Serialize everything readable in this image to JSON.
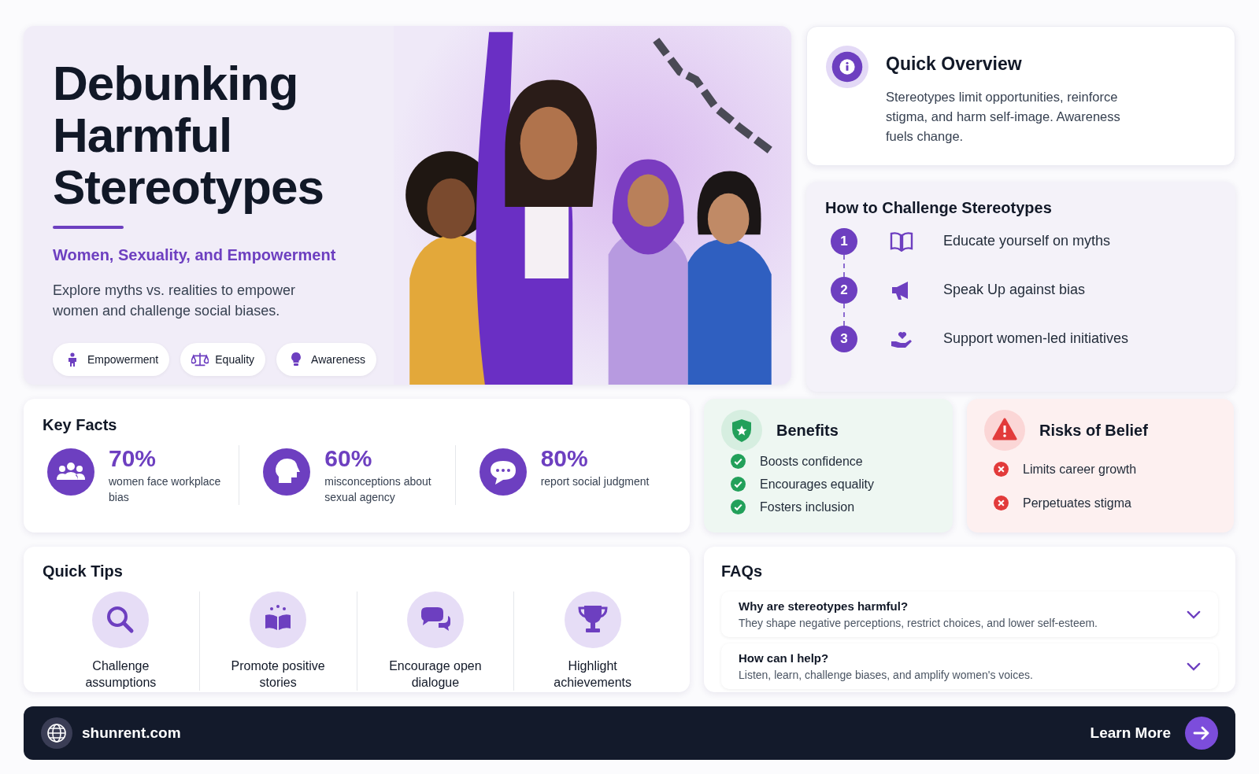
{
  "hero": {
    "title": "Debunking Harmful Stereotypes",
    "subtitle": "Women, Sexuality, and Empowerment",
    "description": "Explore myths vs. realities to empower women and challenge social biases.",
    "tags": [
      "Empowerment",
      "Equality",
      "Awareness"
    ]
  },
  "overview": {
    "title": "Quick Overview",
    "text": "Stereotypes limit opportunities, reinforce stigma, and harm self-image. Awareness fuels change."
  },
  "challenge": {
    "title": "How to Challenge Stereotypes",
    "steps": [
      {
        "number": "1",
        "text": "Educate yourself on myths"
      },
      {
        "number": "2",
        "text": "Speak Up against bias"
      },
      {
        "number": "3",
        "text": "Support women-led initiatives"
      }
    ]
  },
  "key_facts": {
    "title": "Key Facts",
    "facts": [
      {
        "value": "70%",
        "label": "women face workplace bias"
      },
      {
        "value": "60%",
        "label": "misconceptions about sexual agency"
      },
      {
        "value": "80%",
        "label": "report social judgment"
      }
    ]
  },
  "benefits": {
    "title": "Benefits",
    "items": [
      "Boosts confidence",
      "Encourages equality",
      "Fosters inclusion"
    ]
  },
  "risks": {
    "title": "Risks of Belief",
    "items": [
      "Limits career growth",
      "Perpetuates stigma"
    ]
  },
  "quick_tips": {
    "title": "Quick Tips",
    "tips": [
      "Challenge assumptions",
      "Promote positive stories",
      "Encourage open dialogue",
      "Highlight achievements"
    ]
  },
  "faqs": {
    "title": "FAQs",
    "items": [
      {
        "question": "Why are stereotypes harmful?",
        "answer": "They shape negative perceptions, restrict choices, and lower self-esteem."
      },
      {
        "question": "How can I help?",
        "answer": "Listen, learn, challenge biases, and amplify women's voices."
      }
    ]
  },
  "footer": {
    "site": "shunrent.com",
    "button": "Learn More"
  }
}
